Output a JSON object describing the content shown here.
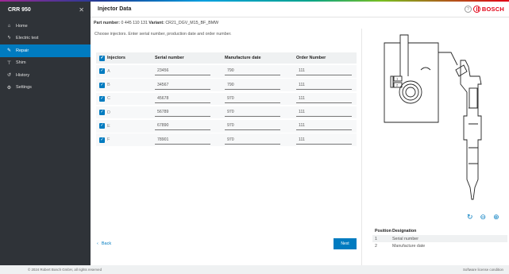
{
  "app": {
    "title": "CRR 950",
    "close_glyph": "✕"
  },
  "sidebar": {
    "items": [
      {
        "label": "Home",
        "icon": "⌂",
        "active": false
      },
      {
        "label": "Electric test",
        "icon": "ϟ",
        "active": false
      },
      {
        "label": "Repair",
        "icon": "✎",
        "active": true
      },
      {
        "label": "Shim",
        "icon": "⊤",
        "active": false
      },
      {
        "label": "History",
        "icon": "↺",
        "active": false
      },
      {
        "label": "Settings",
        "icon": "⚙",
        "active": false
      }
    ]
  },
  "header": {
    "title": "Injector Data",
    "help": "?",
    "brand": "BOSCH"
  },
  "part": {
    "part_label": "Part number:",
    "part_value": "0 445 110 131",
    "variant_label": "Variant:",
    "variant_value": "CR21_DGV_M15_BF_BMW"
  },
  "main": {
    "instruction": "Choose injectors. Enter serial number, production date and order number."
  },
  "table": {
    "headers": [
      "Injectors",
      "Serial number",
      "Manufacture date",
      "Order Number"
    ],
    "rows": [
      {
        "id": "A",
        "serial": "23456",
        "date": "790",
        "order": "111"
      },
      {
        "id": "B",
        "serial": "34567",
        "date": "790",
        "order": "111"
      },
      {
        "id": "C",
        "serial": "45678",
        "date": "970",
        "order": "111"
      },
      {
        "id": "D",
        "serial": "56789",
        "date": "970",
        "order": "111"
      },
      {
        "id": "E",
        "serial": "67890",
        "date": "970",
        "order": "111"
      },
      {
        "id": "F",
        "serial": "78901",
        "date": "970",
        "order": "111"
      }
    ]
  },
  "actions": {
    "back": "Back",
    "back_glyph": "‹",
    "next": "Next"
  },
  "positions": {
    "headers": [
      "Position",
      "Designation"
    ],
    "rows": [
      {
        "pos": "1",
        "desc": "Serial number"
      },
      {
        "pos": "2",
        "desc": "Manufacture date"
      }
    ]
  },
  "footer": {
    "copyright": "© 2024 Robert Bosch GmbH, all rights reserved",
    "license": "Software license condition"
  }
}
